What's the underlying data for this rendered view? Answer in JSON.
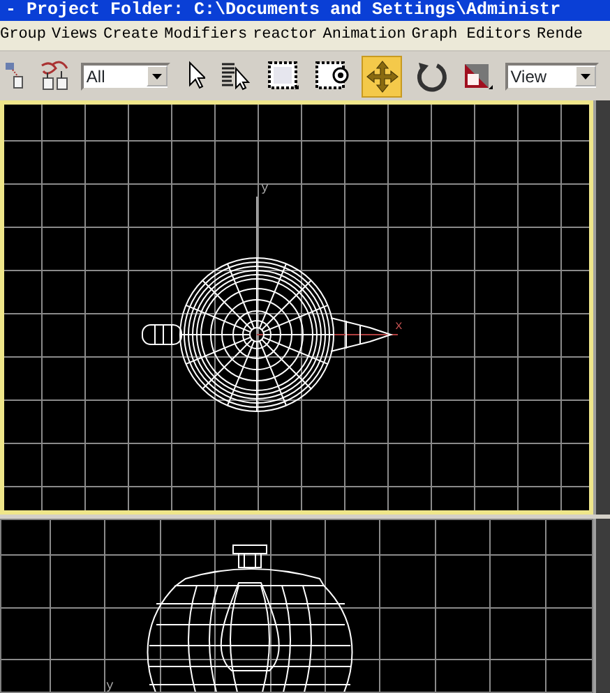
{
  "window": {
    "title": "- Project Folder: C:\\Documents and Settings\\Administr"
  },
  "menu": [
    "Group",
    "Views",
    "Create",
    "Modifiers",
    "reactor",
    "Animation",
    "Graph Editors",
    "Rende"
  ],
  "toolbar": [
    {
      "kind": "link",
      "selected": false
    },
    {
      "kind": "bind",
      "selected": false
    },
    {
      "kind": "dropdown",
      "value": "All"
    },
    {
      "kind": "pointer",
      "selected": false
    },
    {
      "kind": "namelist",
      "selected": false
    },
    {
      "kind": "region",
      "selected": false
    },
    {
      "kind": "crossing",
      "selected": false
    },
    {
      "kind": "move",
      "selected": true
    },
    {
      "kind": "rotate",
      "selected": false
    },
    {
      "kind": "scale",
      "selected": false
    },
    {
      "kind": "dropdown",
      "value": "View"
    }
  ],
  "viewports": [
    {
      "kind": "top",
      "active": true,
      "axis_labels": [
        "y",
        "x"
      ]
    },
    {
      "kind": "front",
      "active": false,
      "axis_labels": [
        "y"
      ]
    }
  ]
}
